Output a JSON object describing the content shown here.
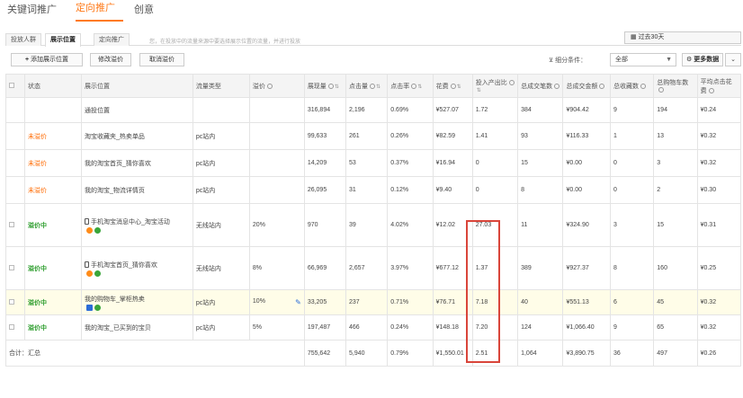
{
  "nav": {
    "tabs": [
      "关键词推广",
      "定向推广",
      "创意"
    ],
    "active": 1
  },
  "subnav": {
    "tabs": [
      "投放人群",
      "展示位置",
      "定向推广"
    ],
    "active": 1,
    "hint": "您，在投放中的流量来源中要选择展示位置的流量，并进行投放",
    "date_label": "过去30天"
  },
  "toolbar": {
    "add_label": "添加展示位置",
    "edit_bid_label": "修改溢价",
    "cancel_bid_label": "取消溢价",
    "filter_label": "细分条件：",
    "filter_value": "全部",
    "more_label": "更多数据"
  },
  "columns": [
    "",
    "状态",
    "展示位置",
    "流量类型",
    "溢价",
    "展现量",
    "点击量",
    "点击率",
    "花费",
    "投入产出比",
    "总成交笔数",
    "总成交金额",
    "总收藏数",
    "总购物车数",
    "平均点击花费"
  ],
  "rows": [
    {
      "checkbox": false,
      "status": "",
      "status_class": "",
      "position": "通投位置",
      "icons": [],
      "phone": false,
      "traffic": "",
      "premium": "",
      "pen": false,
      "impr": "316,894",
      "clicks": "2,196",
      "ctr": "0.69%",
      "cost": "¥527.07",
      "roi": "1.72",
      "orders": "384",
      "amount": "¥904.42",
      "fav": "9",
      "cart": "194",
      "cpc": "¥0.24",
      "hl": false
    },
    {
      "checkbox": false,
      "status": "未溢价",
      "status_class": "status-red",
      "position": "淘宝收藏夹_热卖单品",
      "icons": [],
      "phone": false,
      "traffic": "pc站内",
      "premium": "",
      "pen": false,
      "impr": "99,633",
      "clicks": "261",
      "ctr": "0.26%",
      "cost": "¥82.59",
      "roi": "1.41",
      "orders": "93",
      "amount": "¥116.33",
      "fav": "1",
      "cart": "13",
      "cpc": "¥0.32",
      "hl": false
    },
    {
      "checkbox": false,
      "status": "未溢价",
      "status_class": "status-red",
      "position": "我的淘宝首页_猜你喜欢",
      "icons": [],
      "phone": false,
      "traffic": "pc站内",
      "premium": "",
      "pen": false,
      "impr": "14,209",
      "clicks": "53",
      "ctr": "0.37%",
      "cost": "¥16.94",
      "roi": "0",
      "orders": "15",
      "amount": "¥0.00",
      "fav": "0",
      "cart": "3",
      "cpc": "¥0.32",
      "hl": false
    },
    {
      "checkbox": false,
      "status": "未溢价",
      "status_class": "status-red",
      "position": "我的淘宝_物流详情页",
      "icons": [],
      "phone": false,
      "traffic": "pc站内",
      "premium": "",
      "pen": false,
      "impr": "26,095",
      "clicks": "31",
      "ctr": "0.12%",
      "cost": "¥9.40",
      "roi": "0",
      "orders": "8",
      "amount": "¥0.00",
      "fav": "0",
      "cart": "2",
      "cpc": "¥0.30",
      "hl": false
    },
    {
      "checkbox": true,
      "status": "溢价中",
      "status_class": "status-green",
      "position": "手机淘宝消息中心_淘宝活动",
      "icons": [
        "orange",
        "green"
      ],
      "phone": true,
      "traffic": "无线站内",
      "premium": "20%",
      "pen": false,
      "impr": "970",
      "clicks": "39",
      "ctr": "4.02%",
      "cost": "¥12.02",
      "roi": "27.03",
      "orders": "11",
      "amount": "¥324.90",
      "fav": "3",
      "cart": "15",
      "cpc": "¥0.31",
      "hl": false
    },
    {
      "checkbox": true,
      "status": "溢价中",
      "status_class": "status-green",
      "position": "手机淘宝首页_猜你喜欢",
      "icons": [
        "orange",
        "green"
      ],
      "phone": true,
      "traffic": "无线站内",
      "premium": "8%",
      "pen": false,
      "impr": "66,969",
      "clicks": "2,657",
      "ctr": "3.97%",
      "cost": "¥677.12",
      "roi": "1.37",
      "orders": "389",
      "amount": "¥927.37",
      "fav": "8",
      "cart": "160",
      "cpc": "¥0.25",
      "hl": false
    },
    {
      "checkbox": true,
      "status": "溢价中",
      "status_class": "status-green",
      "position": "我的购物车_掌柜热卖",
      "icons": [
        "blue",
        "green"
      ],
      "phone": false,
      "traffic": "pc站内",
      "premium": "10%",
      "pen": true,
      "impr": "33,205",
      "clicks": "237",
      "ctr": "0.71%",
      "cost": "¥76.71",
      "roi": "7.18",
      "orders": "40",
      "amount": "¥551.13",
      "fav": "6",
      "cart": "45",
      "cpc": "¥0.32",
      "hl": true
    },
    {
      "checkbox": true,
      "status": "溢价中",
      "status_class": "status-green",
      "position": "我的淘宝_已买到的宝贝",
      "icons": [],
      "phone": false,
      "traffic": "pc站内",
      "premium": "5%",
      "pen": false,
      "impr": "197,487",
      "clicks": "466",
      "ctr": "0.24%",
      "cost": "¥148.18",
      "roi": "7.20",
      "orders": "124",
      "amount": "¥1,066.40",
      "fav": "9",
      "cart": "65",
      "cpc": "¥0.32",
      "hl": false
    }
  ],
  "total": {
    "label": "合计：汇总",
    "impr": "755,642",
    "clicks": "5,940",
    "ctr": "0.79%",
    "cost": "¥1,550.01",
    "roi": "2.51",
    "orders": "1,064",
    "amount": "¥3,890.75",
    "fav": "36",
    "cart": "497",
    "cpc": "¥0.26"
  }
}
